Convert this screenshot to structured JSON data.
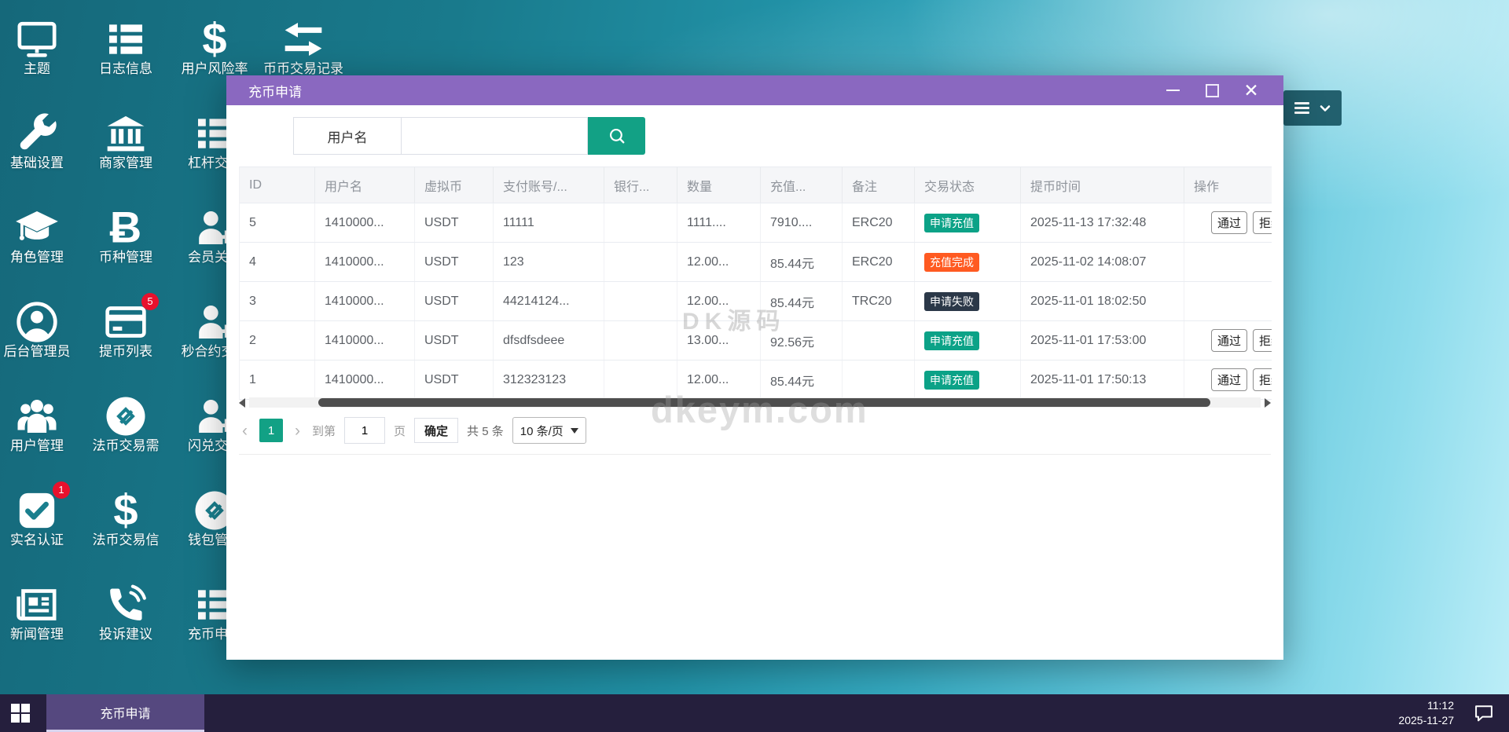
{
  "desktop": {
    "columns": [
      {
        "items": [
          {
            "label": "主题",
            "icon": "monitor"
          },
          {
            "label": "基础设置",
            "icon": "wrench"
          },
          {
            "label": "角色管理",
            "icon": "graduation-cap"
          },
          {
            "label": "后台管理员",
            "icon": "user-circle"
          },
          {
            "label": "用户管理",
            "icon": "users"
          },
          {
            "label": "实名认证",
            "icon": "check-square",
            "badge": "1"
          },
          {
            "label": "新闻管理",
            "icon": "newspaper"
          }
        ]
      },
      {
        "items": [
          {
            "label": "日志信息",
            "icon": "list"
          },
          {
            "label": "商家管理",
            "icon": "bank"
          },
          {
            "label": "币种管理",
            "icon": "bitcoin"
          },
          {
            "label": "提币列表",
            "icon": "credit-card",
            "badge": "5"
          },
          {
            "label": "法币交易需",
            "icon": "exchange-circle"
          },
          {
            "label": "法币交易信",
            "icon": "dollar"
          },
          {
            "label": "投诉建议",
            "icon": "phone"
          }
        ]
      },
      {
        "items": [
          {
            "label": "用户风险率",
            "icon": "dollar"
          },
          {
            "label": "杠杆交易",
            "icon": "list"
          },
          {
            "label": "会员关系",
            "icon": "user-plus"
          },
          {
            "label": "秒合约交易",
            "icon": "user-plus"
          },
          {
            "label": "闪兑交易",
            "icon": "user-plus"
          },
          {
            "label": "钱包管理",
            "icon": "exchange-circle"
          },
          {
            "label": "充币申请",
            "icon": "list"
          }
        ]
      },
      {
        "items": [
          {
            "label": "币币交易记录",
            "icon": "transfer"
          }
        ]
      }
    ]
  },
  "modal": {
    "title": "充币申请",
    "search": {
      "label": "用户名",
      "value": "",
      "placeholder": ""
    },
    "table": {
      "headers": [
        "ID",
        "用户名",
        "虚拟币",
        "支付账号/...",
        "银行...",
        "数量",
        "充值...",
        "备注",
        "交易状态",
        "提币时间",
        "操作"
      ],
      "rows": [
        {
          "cells": [
            "5",
            "1410000...",
            "USDT",
            "11111",
            "",
            "1111....",
            "7910....",
            "ERC20"
          ],
          "status": "申请充值",
          "status_style": "teal",
          "time": "2025-11-13 17:32:48",
          "actions": [
            "通过",
            "拒绝"
          ]
        },
        {
          "cells": [
            "4",
            "1410000...",
            "USDT",
            "123",
            "",
            "12.00...",
            "85.44元",
            "ERC20"
          ],
          "status": "充值完成",
          "status_style": "orange",
          "time": "2025-11-02 14:08:07",
          "actions": []
        },
        {
          "cells": [
            "3",
            "1410000...",
            "USDT",
            "44214124...",
            "",
            "12.00...",
            "85.44元",
            "TRC20"
          ],
          "status": "申请失败",
          "status_style": "dark",
          "time": "2025-11-01 18:02:50",
          "actions": []
        },
        {
          "cells": [
            "2",
            "1410000...",
            "USDT",
            "dfsdfsdeee",
            "",
            "13.00...",
            "92.56元",
            ""
          ],
          "status": "申请充值",
          "status_style": "teal",
          "time": "2025-11-01 17:53:00",
          "actions": [
            "通过",
            "拒绝"
          ]
        },
        {
          "cells": [
            "1",
            "1410000...",
            "USDT",
            "312323123",
            "",
            "12.00...",
            "85.44元",
            ""
          ],
          "status": "申请充值",
          "status_style": "teal",
          "time": "2025-11-01 17:50:13",
          "actions": [
            "通过",
            "拒绝"
          ]
        }
      ]
    },
    "pagination": {
      "prev": "‹",
      "page": "1",
      "next": "›",
      "goto_label": "到第",
      "goto_value": "1",
      "page_unit": "页",
      "confirm": "确定",
      "total": "共 5 条",
      "per_page": "10 条/页"
    },
    "watermarks": [
      "DK源码",
      "dkeym.com"
    ]
  },
  "taskbar": {
    "active_task": "充币申请",
    "time": "11:12",
    "date": "2025-11-27"
  },
  "colors": {
    "titlebar": "#8a68c0",
    "accent_teal": "#12a185",
    "status": {
      "teal": "#0ca287",
      "orange": "#ff5a21",
      "dark": "#2b3848"
    },
    "badge_red": "#e8112d",
    "taskbar": "#251f3d",
    "task_active": "#55487f"
  }
}
